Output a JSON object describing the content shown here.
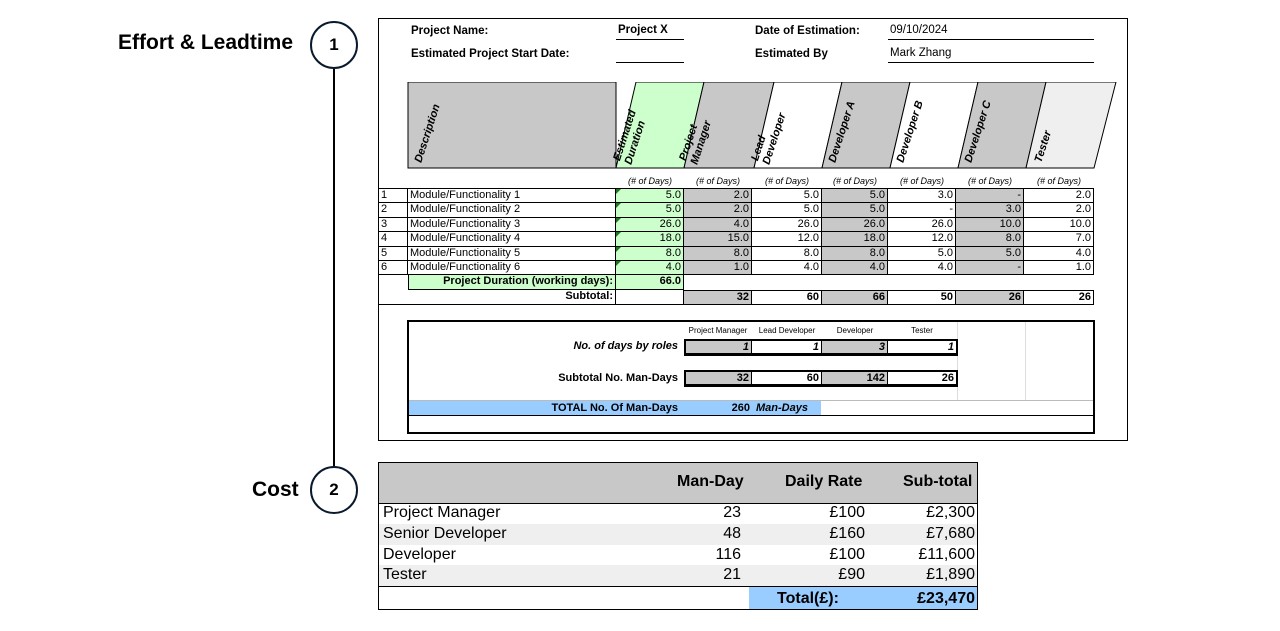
{
  "steps": [
    {
      "num": "1",
      "label": "Effort & Leadtime"
    },
    {
      "num": "2",
      "label": "Cost"
    }
  ],
  "header": {
    "project_name_label": "Project Name:",
    "project_name_value": "Project X",
    "start_date_label": "Estimated Project Start Date:",
    "start_date_value": "",
    "date_label": "Date of Estimation:",
    "date_value": "09/10/2024",
    "by_label": "Estimated By",
    "by_value": "Mark Zhang"
  },
  "columns": {
    "description": "Description",
    "duration": "Estimated\nDuration",
    "pm": "Project\nManager",
    "lead": "Lead\nDeveloper",
    "devA": "Developer A",
    "devB": "Developer B",
    "devC": "Developer C",
    "tester": "Tester",
    "units": "(# of Days)"
  },
  "rows": [
    {
      "n": "1",
      "desc": "Module/Functionality 1",
      "dur": "5.0",
      "pm": "2.0",
      "lead": "5.0",
      "devA": "5.0",
      "devB": "3.0",
      "devC": "-",
      "tester": "2.0"
    },
    {
      "n": "2",
      "desc": "Module/Functionality 2",
      "dur": "5.0",
      "pm": "2.0",
      "lead": "5.0",
      "devA": "5.0",
      "devB": "-",
      "devC": "3.0",
      "tester": "2.0"
    },
    {
      "n": "3",
      "desc": "Module/Functionality 3",
      "dur": "26.0",
      "pm": "4.0",
      "lead": "26.0",
      "devA": "26.0",
      "devB": "26.0",
      "devC": "10.0",
      "tester": "10.0"
    },
    {
      "n": "4",
      "desc": "Module/Functionality 4",
      "dur": "18.0",
      "pm": "15.0",
      "lead": "12.0",
      "devA": "18.0",
      "devB": "12.0",
      "devC": "8.0",
      "tester": "7.0"
    },
    {
      "n": "5",
      "desc": "Module/Functionality 5",
      "dur": "8.0",
      "pm": "8.0",
      "lead": "8.0",
      "devA": "8.0",
      "devB": "5.0",
      "devC": "5.0",
      "tester": "4.0"
    },
    {
      "n": "6",
      "desc": "Module/Functionality 6",
      "dur": "4.0",
      "pm": "1.0",
      "lead": "4.0",
      "devA": "4.0",
      "devB": "4.0",
      "devC": "-",
      "tester": "1.0"
    }
  ],
  "project_duration": {
    "label": "Project Duration (working days):",
    "value": "66.0"
  },
  "subtotal": {
    "label": "Subtotal:",
    "pm": "32",
    "lead": "60",
    "devA": "66",
    "devB": "50",
    "devC": "26",
    "tester": "26"
  },
  "roles": {
    "headers": [
      "Project Manager",
      "Lead Developer",
      "Developer",
      "Tester"
    ],
    "days_label": "No. of days by roles",
    "days": [
      "1",
      "1",
      "3",
      "1"
    ],
    "mandays_label": "Subtotal No. Man-Days",
    "mandays": [
      "32",
      "60",
      "142",
      "26"
    ],
    "total_label": "TOTAL No. Of Man-Days",
    "total_value": "260",
    "total_unit": "Man-Days"
  },
  "cost": {
    "headers": {
      "manday": "Man-Day",
      "rate": "Daily Rate",
      "subtotal": "Sub-total"
    },
    "rows": [
      {
        "role": "Project Manager",
        "manday": "23",
        "rate": "£100",
        "subtotal": "£2,300"
      },
      {
        "role": "Senior Developer",
        "manday": "48",
        "rate": "£160",
        "subtotal": "£7,680"
      },
      {
        "role": "Developer",
        "manday": "116",
        "rate": "£100",
        "subtotal": "£11,600"
      },
      {
        "role": "Tester",
        "manday": "21",
        "rate": "£90",
        "subtotal": "£1,890"
      }
    ],
    "total_label": "Total(£):",
    "total_value": "£23,470"
  },
  "colors": {
    "grey": "#c8c8c8",
    "green": "#ccffcc",
    "blue": "#99ccff",
    "circle_border": "#0a1a2e"
  }
}
